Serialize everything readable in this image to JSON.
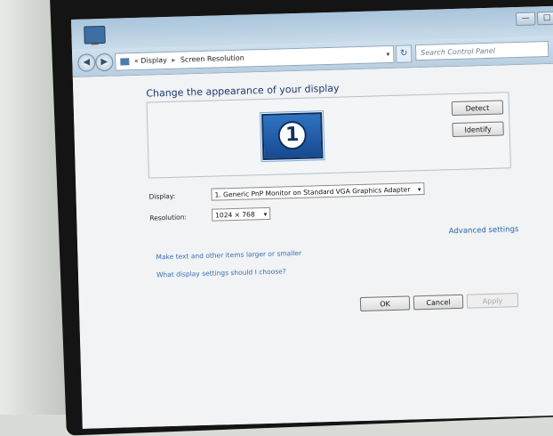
{
  "window": {
    "minimize": "—",
    "maximize": "□",
    "close": "✕"
  },
  "nav": {
    "back": "◀",
    "forward": "▶"
  },
  "address": {
    "prefix": "«",
    "crumb1": "Display",
    "separator": "▸",
    "crumb2": "Screen Resolution",
    "dropdown": "▾",
    "refresh": "↻"
  },
  "search": {
    "placeholder": "Search Control Panel"
  },
  "main": {
    "heading": "Change the appearance of your display",
    "monitor_number": "1",
    "detect_label": "Detect",
    "identify_label": "Identify",
    "display_label": "Display:",
    "display_value": "1. Generic PnP Monitor on Standard VGA Graphics Adapter",
    "resolution_label": "Resolution:",
    "resolution_value": "1024 × 768",
    "advanced_link": "Advanced settings",
    "text_size_link": "Make text and other items larger or smaller",
    "help_link": "What display settings should I choose?",
    "ok_label": "OK",
    "cancel_label": "Cancel",
    "apply_label": "Apply",
    "dropdown_arrow": "▾"
  },
  "colors": {
    "heading": "#1e3a6e",
    "link": "#3a6fb4",
    "monitor": "#2f73c2"
  }
}
